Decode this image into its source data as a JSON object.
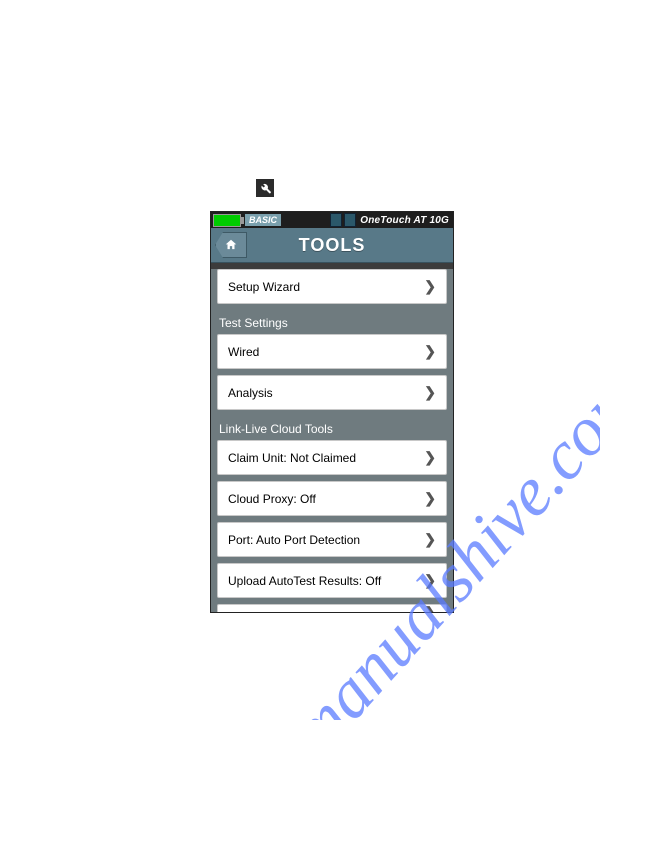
{
  "watermark_text": "manualshive.com",
  "status": {
    "mode": "BASIC",
    "device_title": "OneTouch AT 10G"
  },
  "screen": {
    "title": "TOOLS",
    "rows": [
      {
        "label": "Setup Wizard"
      }
    ],
    "sections": [
      {
        "header": "Test Settings",
        "rows": [
          {
            "label": "Wired"
          },
          {
            "label": "Analysis"
          }
        ]
      },
      {
        "header": "Link-Live Cloud Tools",
        "rows": [
          {
            "label": "Claim Unit: Not Claimed"
          },
          {
            "label": "Cloud Proxy: Off"
          },
          {
            "label": "Port: Auto Port Detection"
          },
          {
            "label": "Upload AutoTest Results: Off"
          }
        ]
      }
    ]
  }
}
